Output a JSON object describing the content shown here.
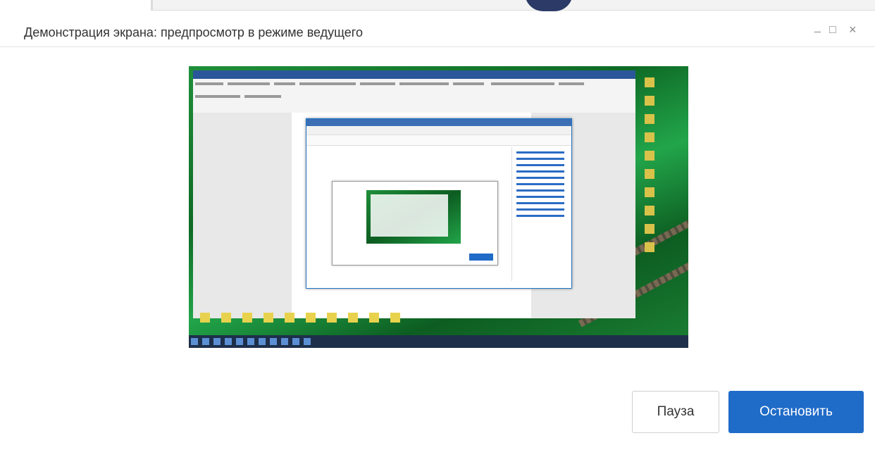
{
  "window": {
    "title": "Демонстрация экрана: предпросмотр в режиме ведущего",
    "minimize_glyph": "_",
    "maximize_glyph": "□",
    "close_glyph": "×"
  },
  "preview": {
    "description_icon": "screen-share-preview-image"
  },
  "actions": {
    "pause_label": "Пауза",
    "stop_label": "Остановить"
  },
  "colors": {
    "primary": "#1f6bc8",
    "title_text": "#333333",
    "border": "#e3e3e3"
  }
}
